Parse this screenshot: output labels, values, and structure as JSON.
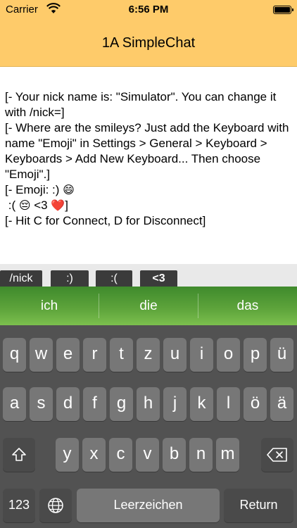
{
  "status": {
    "carrier": "Carrier",
    "time": "6:56 PM"
  },
  "nav": {
    "title": "1A SimpleChat"
  },
  "chat": {
    "line1": "[- Your nick name is: \"Simulator\". You can change it with /nick=]",
    "line2": "[- Where are the smileys? Just add the Keyboard with name \"Emoji\" in Settings > General > Keyboard > Keyboards > Add New Keyboard... Then choose \"Emoji\".]",
    "line3_text": "[- Emoji: :) ",
    "line3_emoji": "😄",
    "line4_text1": " :( ",
    "line4_emoji1": "😔",
    "line4_text2": " <3 ",
    "line4_emoji2": "❤️",
    "line4_text3": "]",
    "line5": "[- Hit C for Connect, D for Disconnect]"
  },
  "quick": [
    "/nick",
    ":)",
    ":(",
    "<3"
  ],
  "suggestions": [
    "ich",
    "die",
    "das"
  ],
  "keys": {
    "row1": [
      "q",
      "w",
      "e",
      "r",
      "t",
      "z",
      "u",
      "i",
      "o",
      "p",
      "ü"
    ],
    "row2": [
      "a",
      "s",
      "d",
      "f",
      "g",
      "h",
      "j",
      "k",
      "l",
      "ö",
      "ä"
    ],
    "row3": [
      "y",
      "x",
      "c",
      "v",
      "b",
      "n",
      "m"
    ],
    "numbers": "123",
    "space": "Leerzeichen",
    "return": "Return"
  },
  "icons": {
    "wifi": "wifi-icon",
    "battery": "battery-icon",
    "shift": "shift-icon",
    "backspace": "backspace-icon",
    "globe": "globe-icon"
  },
  "colors": {
    "navbar": "#fecb6a",
    "suggest_bar": "#5fa53c",
    "keyboard_bg": "#525252",
    "key": "#777777",
    "key_dark": "#4a4a4a",
    "quick_button": "#3b3b3b"
  }
}
